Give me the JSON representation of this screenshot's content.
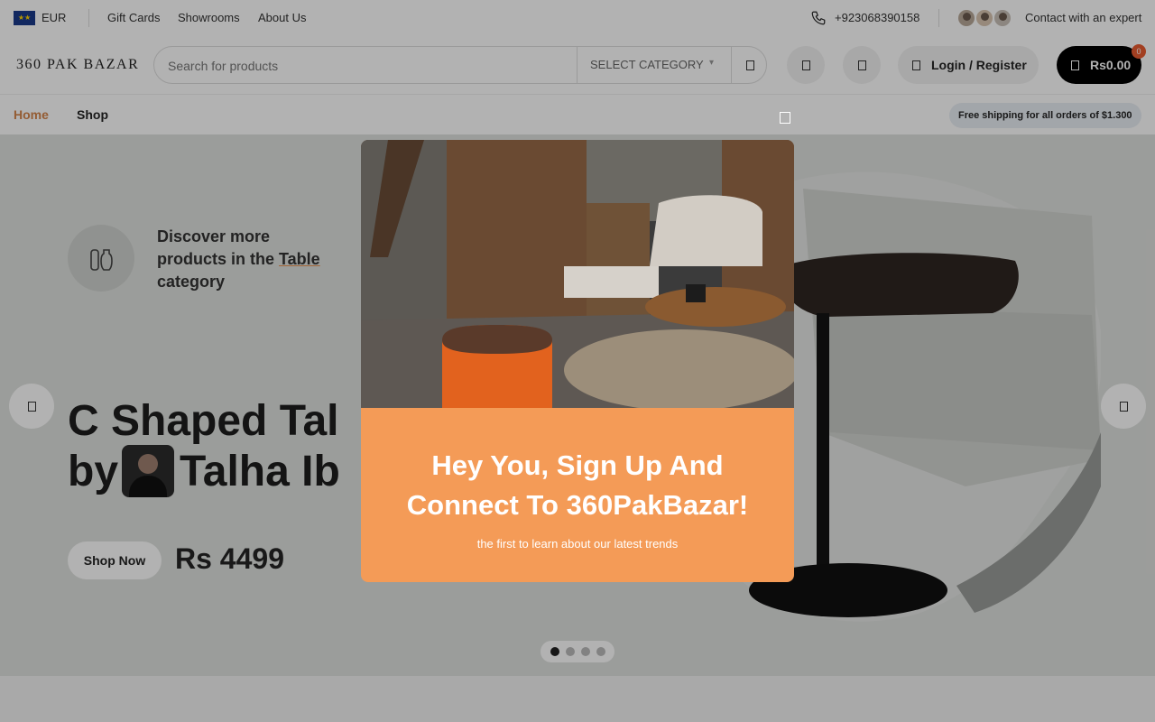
{
  "topbar": {
    "currency": "EUR",
    "links": [
      "Gift Cards",
      "Showrooms",
      "About Us"
    ],
    "phone": "+923068390158",
    "expert": "Contact with an expert"
  },
  "header": {
    "logo": "360 PAK BAZAR",
    "search_placeholder": "Search for products",
    "category": "SELECT CATEGORY",
    "login": "Login / Register",
    "cart_total": "Rs0.00",
    "cart_count": "0"
  },
  "nav": {
    "items": [
      "Home",
      "Shop"
    ],
    "shipping": "Free shipping for all orders of $1.300"
  },
  "hero": {
    "category_prefix": "Discover more products in the ",
    "category_name": "Table",
    "category_suffix": " category",
    "title_line1": "C Shaped Tal",
    "title_by": "by",
    "title_author": "Talha Ib",
    "shop_now": "Shop Now",
    "price": "Rs 4499",
    "slides": 4,
    "active_slide": 1
  },
  "modal": {
    "heading": "Hey You, Sign Up And Connect To 360PakBazar!",
    "subtext": "the first to learn about our latest trends"
  },
  "colors": {
    "accent": "#f49b57",
    "home_active": "#d4844a",
    "cart_bg": "#000000",
    "badge": "#e85b30"
  },
  "icons": [
    "eu-flag-icon",
    "phone-icon",
    "search-icon",
    "compare-icon",
    "wishlist-icon",
    "user-icon",
    "cart-icon",
    "vase-icon",
    "arrow-left-icon",
    "arrow-right-icon",
    "close-icon"
  ]
}
